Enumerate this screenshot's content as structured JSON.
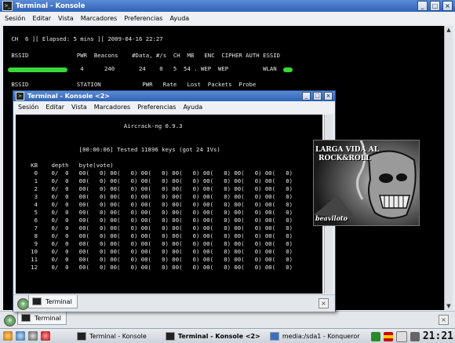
{
  "outer": {
    "title": "Terminal - Konsole",
    "menu": [
      "Sesión",
      "Editar",
      "Vista",
      "Marcadores",
      "Preferencias",
      "Ayuda"
    ],
    "term_lines": [
      " CH  6 ][ Elapsed: 5 mins ][ 2009-04-16 22:27",
      "",
      " BSSID              PWR  Beacons    #Data, #/s  CH  MB   ENC  CIPHER AUTH ESSID",
      "",
      "                     4      240       24    0   5  54 . WEP  WEP          WLAN",
      "",
      " BSSID              STATION            PWR   Rate   Lost  Packets  Probe"
    ],
    "tab_label": "Terminal"
  },
  "inner": {
    "title": "Terminal - Konsole <2>",
    "menu": [
      "Sesión",
      "Editar",
      "Vista",
      "Marcadores",
      "Preferencias",
      "Ayuda"
    ],
    "term_lines": [
      "",
      "                              Aircrack-ng 0.9.3",
      "",
      "",
      "                 [00:00:06] Tested 11896 keys (got 24 IVs)",
      "",
      "   KB    depth   byte(vote)",
      "    0    0/  0   00(   0) 00(   0) 00(   0) 00(   0) 00(   0) 00(   0) 00(   0)",
      "    1    0/  0   00(   0) 00(   0) 00(   0) 00(   0) 00(   0) 00(   0) 00(   0)",
      "    2    0/  0   00(   0) 00(   0) 00(   0) 00(   0) 00(   0) 00(   0) 00(   0)",
      "    3    0/  0   00(   0) 00(   0) 00(   0) 00(   0) 00(   0) 00(   0) 00(   0)",
      "    4    0/  0   00(   0) 00(   0) 00(   0) 00(   0) 00(   0) 00(   0) 00(   0)",
      "    5    0/  0   00(   0) 00(   0) 00(   0) 00(   0) 00(   0) 00(   0) 00(   0)",
      "    6    0/  0   00(   0) 00(   0) 00(   0) 00(   0) 00(   0) 00(   0) 00(   0)",
      "    7    0/  0   00(   0) 00(   0) 00(   0) 00(   0) 00(   0) 00(   0) 00(   0)",
      "    8    0/  0   00(   0) 00(   0) 00(   0) 00(   0) 00(   0) 00(   0) 00(   0)",
      "    9    0/  0   00(   0) 00(   0) 00(   0) 00(   0) 00(   0) 00(   0) 00(   0)",
      "   10    0/  0   00(   0) 00(   0) 00(   0) 00(   0) 00(   0) 00(   0) 00(   0)",
      "   11    0/  0   00(   0) 00(   0) 00(   0) 00(   0) 00(   0) 00(   0) 00(   0)",
      "   12    0/  0   00(   0) 00(   0) 00(   0) 00(   0) 00(   0) 00(   0) 00(   0)"
    ],
    "tab_label": "Terminal"
  },
  "poster": {
    "line1": "LARGA VIDA AL",
    "line2": "ROCK&ROLL",
    "signature": "beaviloto"
  },
  "taskbar": {
    "tasks": [
      "Terminal - Konsole",
      "Terminal - Konsole <2>",
      "media:/sda1 - Konqueror"
    ],
    "active_task": 1,
    "clock": "21:21"
  },
  "colors": {
    "titlebar": "#2f63b5",
    "terminal_bg": "#000000",
    "terminal_fg": "#e6e6e6",
    "redacted_highlight": "#38d838"
  }
}
